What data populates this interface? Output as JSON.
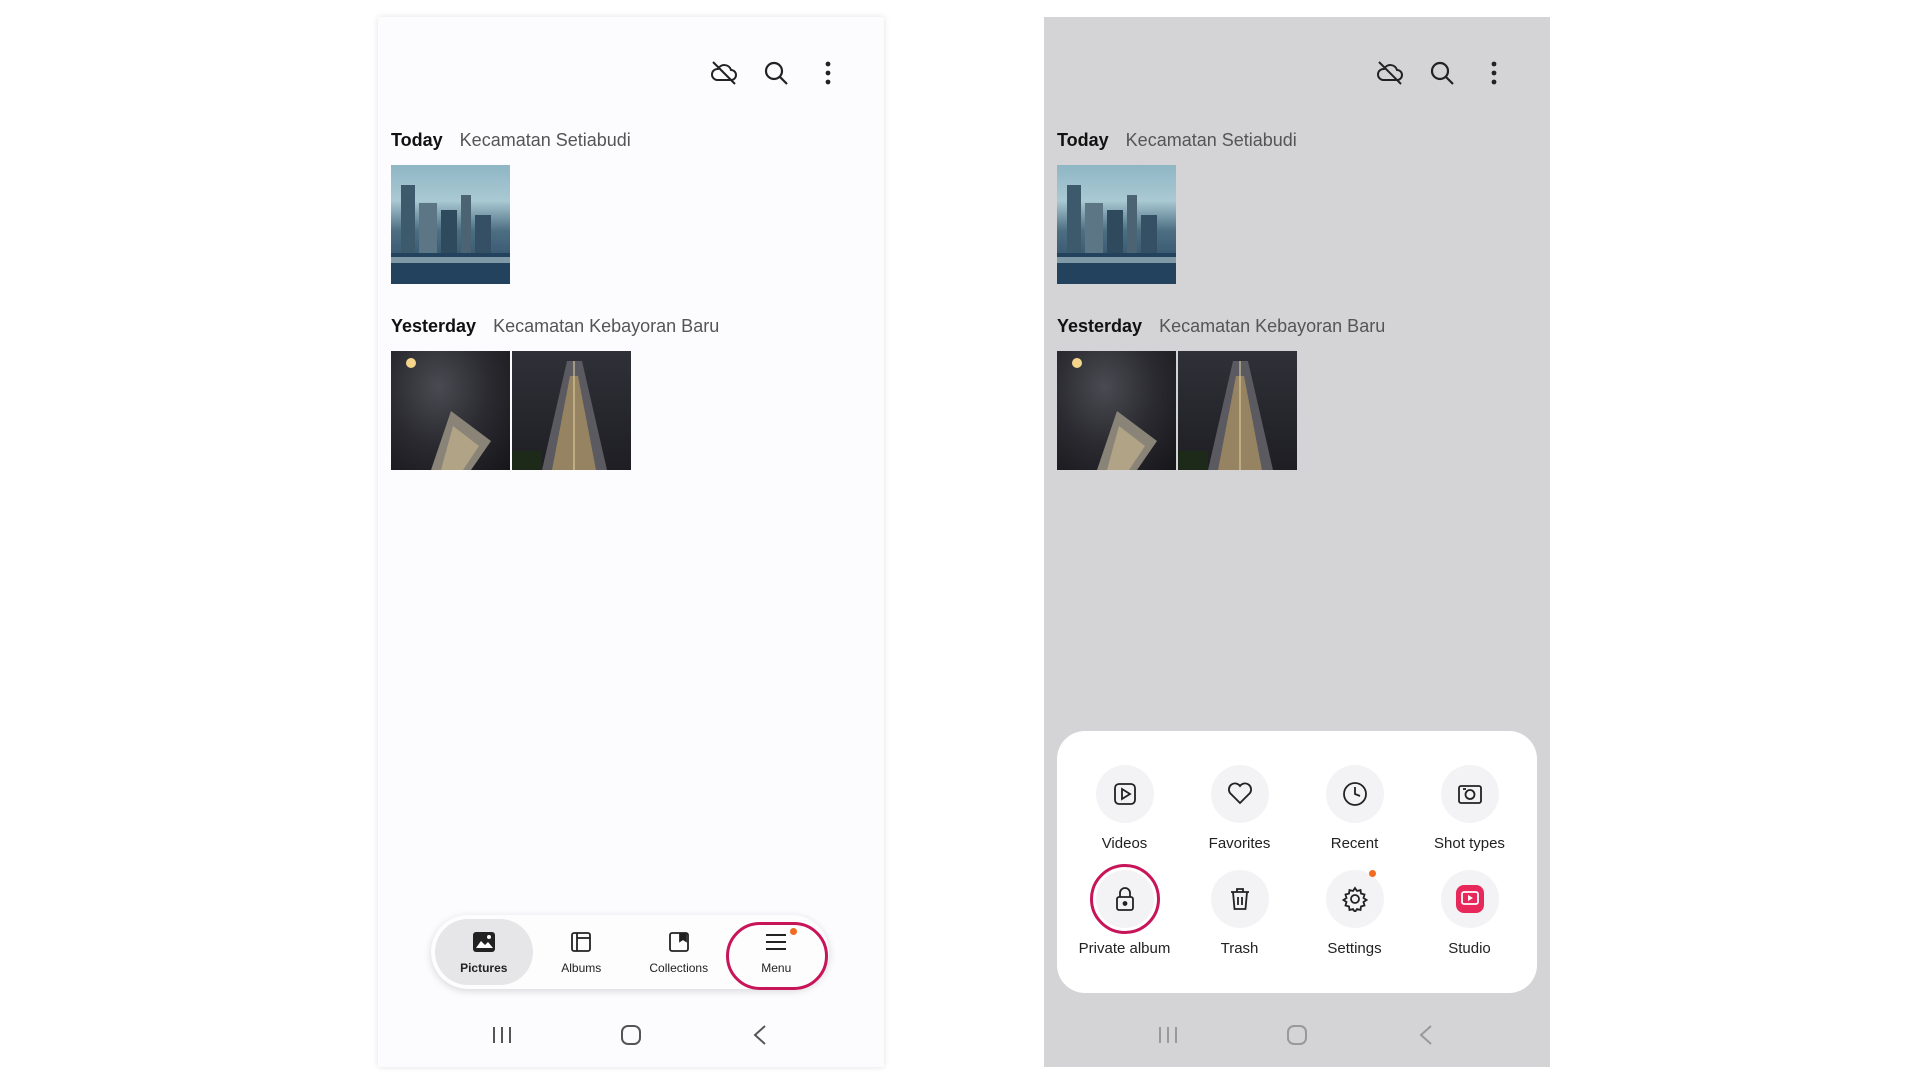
{
  "colors": {
    "highlight": "#c8155a",
    "badge": "#f26b21",
    "studio": "#e8285a"
  },
  "left_phone": {
    "top_icons": [
      "cloud-off-icon",
      "search-icon",
      "more-vert-icon"
    ],
    "sections": [
      {
        "day": "Today",
        "location": "Kecamatan Setiabudi",
        "photo_count": 1
      },
      {
        "day": "Yesterday",
        "location": "Kecamatan Kebayoran Baru",
        "photo_count": 2
      }
    ],
    "nav": {
      "pictures": "Pictures",
      "albums": "Albums",
      "collections": "Collections",
      "menu": "Menu",
      "active": "Pictures",
      "highlighted": "Menu"
    }
  },
  "right_phone": {
    "top_icons": [
      "cloud-off-icon",
      "search-icon",
      "more-vert-icon"
    ],
    "sections": [
      {
        "day": "Today",
        "location": "Kecamatan Setiabudi"
      },
      {
        "day": "Yesterday",
        "location": "Kecamatan Kebayoran Baru"
      }
    ],
    "menu_sheet": {
      "videos": "Videos",
      "favorites": "Favorites",
      "recent": "Recent",
      "shot_types": "Shot types",
      "private_album": "Private album",
      "trash": "Trash",
      "settings": "Settings",
      "studio": "Studio",
      "highlighted": "Private album"
    }
  },
  "system_nav": [
    "recent-apps-icon",
    "home-icon",
    "back-icon"
  ]
}
